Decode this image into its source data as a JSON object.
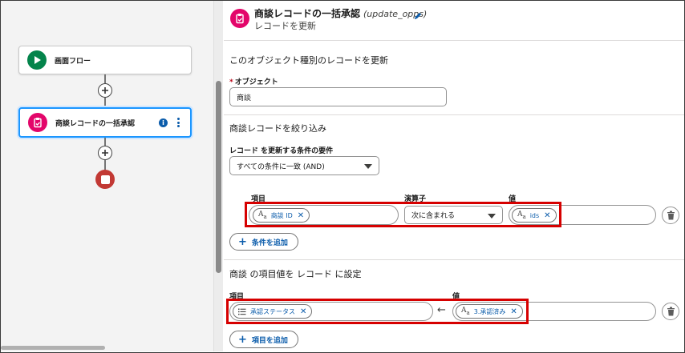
{
  "canvas": {
    "start_node": {
      "label": "画面フロー",
      "icon": "play-icon"
    },
    "update_node": {
      "label": "商談レコードの一括承認",
      "icon": "update-record-icon"
    },
    "end_node": {
      "icon": "stop-icon"
    }
  },
  "header": {
    "title": "商談レコードの一括承認",
    "api_name": "(update_opps)",
    "subtitle": "レコードを更新"
  },
  "object_section": {
    "title": "このオブジェクト種別のレコードを更新",
    "object_label": "オブジェクト",
    "required_marker": "*",
    "object_value": "商談"
  },
  "filter_section": {
    "title": "商談レコードを絞り込み",
    "condition_req_label": "レコード を更新する条件の要件",
    "condition_req_value": "すべての条件に一致 (AND)",
    "col_field": "項目",
    "col_operator": "演算子",
    "col_value": "値",
    "row": {
      "field_type": "A",
      "field_type_sub": "a",
      "field_pill": "商談 ID",
      "operator": "次に含まれる",
      "value_type": "A",
      "value_type_sub": "a",
      "value_pill": "ids"
    },
    "add_condition": "条件を追加"
  },
  "set_section": {
    "title": "商談 の項目値を レコード に設定",
    "col_field": "項目",
    "col_value": "値",
    "row": {
      "field_pill": "承認ステータス",
      "arrow": "←",
      "value_type": "A",
      "value_type_sub": "a",
      "value_pill": "3.承認済み"
    },
    "add_field": "項目を追加"
  },
  "colors": {
    "accent_blue": "#0b5cab",
    "start_green": "#04844b",
    "update_pink": "#e3066a",
    "end_red": "#c23934",
    "highlight_red": "#d60000"
  }
}
